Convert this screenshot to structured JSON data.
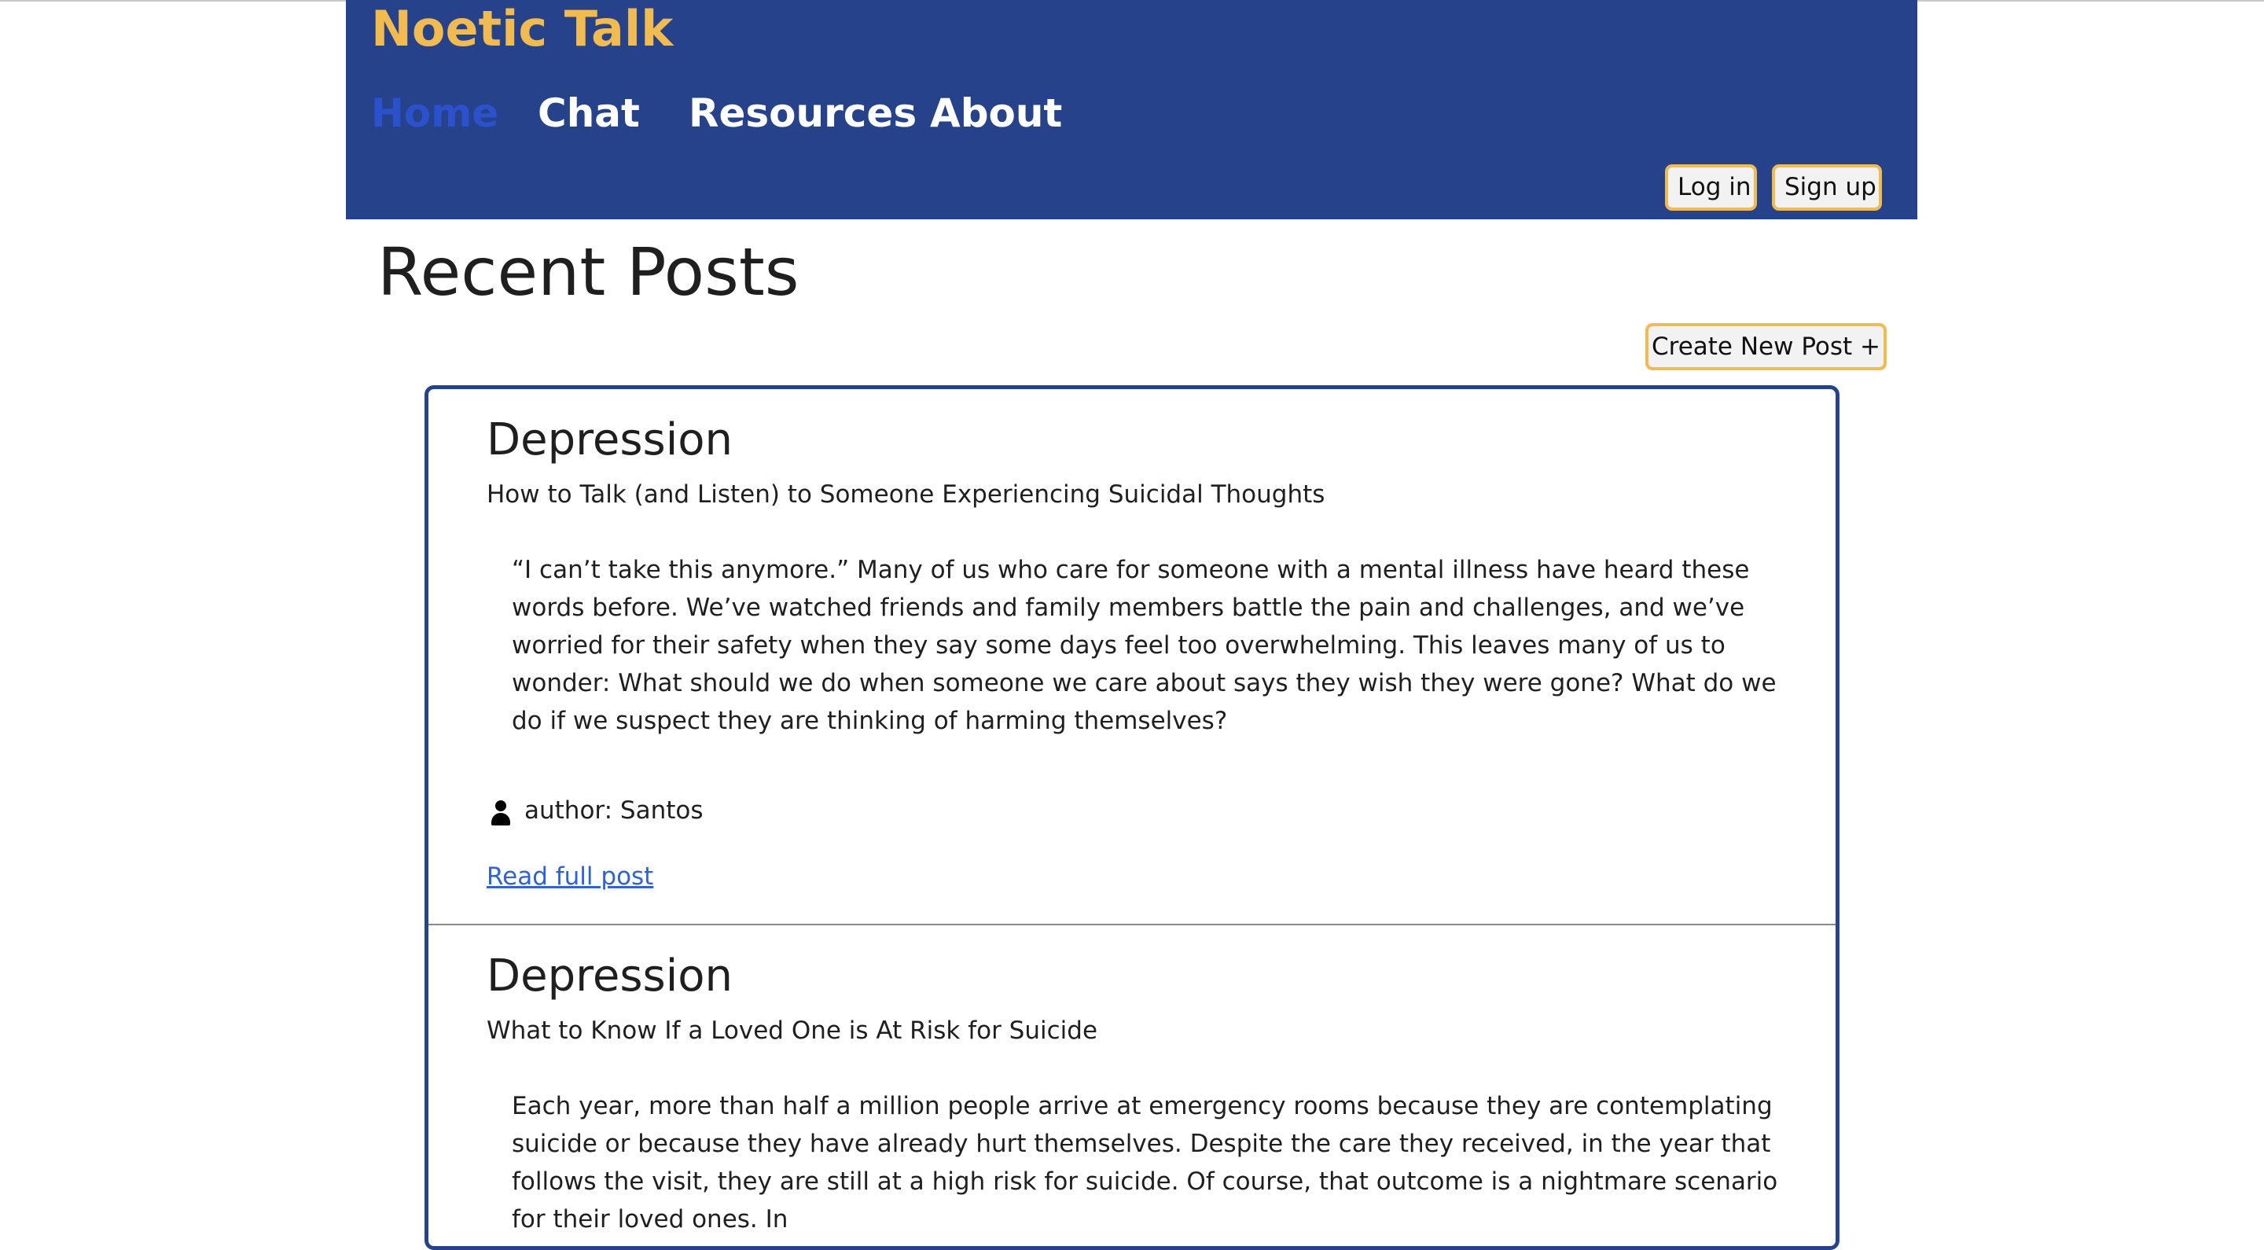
{
  "header": {
    "brand": "Noetic Talk",
    "nav": [
      {
        "label": "Home",
        "active": true
      },
      {
        "label": "Chat",
        "active": false
      },
      {
        "label": "Resources",
        "active": false
      },
      {
        "label": "About",
        "active": false
      }
    ],
    "login_label": "Log in",
    "signup_label": "Sign up"
  },
  "main": {
    "title": "Recent Posts",
    "create_label": "Create New Post +",
    "posts": [
      {
        "category": "Depression",
        "title": "How to Talk (and Listen) to Someone Experiencing Suicidal Thoughts",
        "excerpt": "“I can’t take this anymore.” Many of us who care for someone with a mental illness have heard these words before. We’ve watched friends and family members battle the pain and challenges, and we’ve worried for their safety when they say some days feel too overwhelming. This leaves many of us to wonder: What should we do when someone we care about says they wish they were gone? What do we do if we suspect they are thinking of harming themselves?",
        "author": "author: Santos",
        "read_label": "Read full post"
      },
      {
        "category": "Depression",
        "title": "What to Know If a Loved One is At Risk for Suicide",
        "excerpt": "Each year, more than half a million people arrive at emergency rooms because they are contemplating suicide or because they have already hurt themselves. Despite the care they received, in the year that follows the visit, they are still at a high risk for suicide. Of course, that outcome is a nightmare scenario for their loved ones. In"
      }
    ]
  },
  "colors": {
    "header_bg": "#26428b",
    "brand": "#f2bb50",
    "nav_active": "#2b52cc",
    "button_border": "#f2bb50",
    "link": "#2f62d8"
  },
  "icons": {
    "author": "person-icon"
  }
}
